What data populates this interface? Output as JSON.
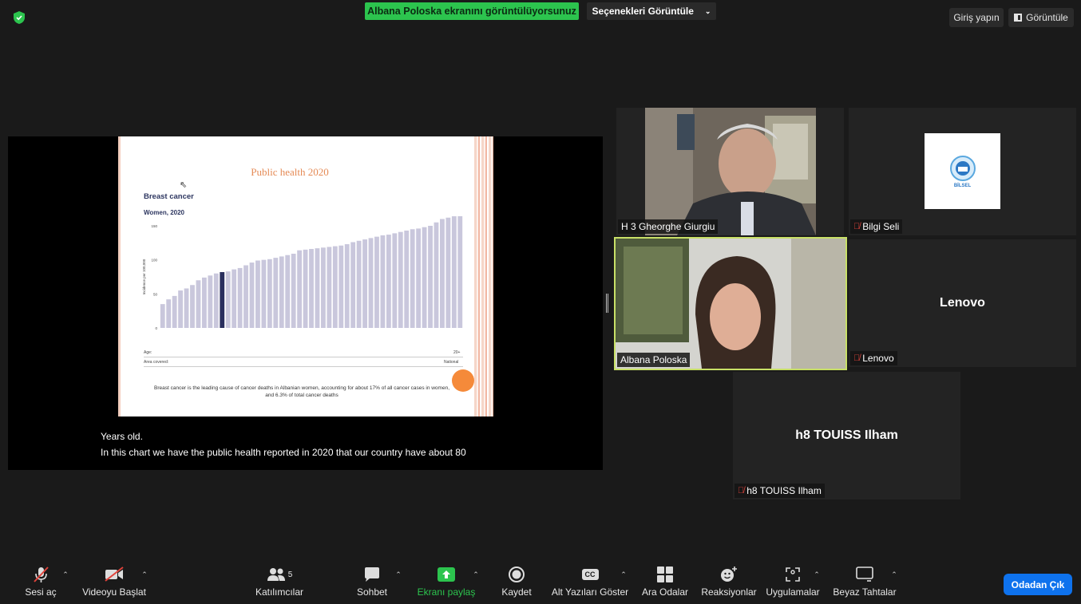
{
  "topbar": {
    "share_banner": "Albana Poloska ekranını görüntülüyorsunuz",
    "view_options": "Seçenekleri Görüntüle",
    "signin": "Giriş yapın",
    "view": "Görüntüle"
  },
  "slide": {
    "title": "Public health 2020",
    "chart_title": "Breast cancer",
    "chart_subtitle": "Women, 2020",
    "age_label": "Age:",
    "age_value": "20+",
    "area_label": "Area covered:",
    "area_value": "National",
    "caption": "Breast cancer is the leading cause of cancer deaths in Albanian women, accounting for about 17% of all cancer cases in women, and 6.3% of total cancer deaths",
    "colors": {
      "bar": "#c9c7dc",
      "highlight": "#2a2f5e",
      "title": "#e58a55"
    }
  },
  "chart_data": {
    "type": "bar",
    "ylabel": "Incidence per 100,000",
    "ylim": [
      0,
      150
    ],
    "yticks": [
      0,
      50,
      100,
      150
    ],
    "highlight_index": 10,
    "values": [
      35,
      42,
      47,
      55,
      58,
      63,
      70,
      74,
      77,
      80,
      82,
      83,
      86,
      88,
      92,
      96,
      99,
      100,
      101,
      103,
      105,
      107,
      109,
      114,
      115,
      116,
      117,
      118,
      119,
      120,
      121,
      123,
      126,
      128,
      130,
      132,
      134,
      136,
      137,
      139,
      141,
      143,
      145,
      146,
      148,
      150,
      155,
      160,
      162,
      164,
      183
    ]
  },
  "captions": {
    "line1": "Years old.",
    "line2": "In this chart we have the public health reported in 2020 that our country have about 80"
  },
  "participants": [
    {
      "name": "H 3 Gheorghe Giurgiu",
      "muted": false
    },
    {
      "name": "Bilgi Seli",
      "muted": true,
      "logo_text": "BİLSEL"
    },
    {
      "name": "Albana Poloska",
      "muted": false
    },
    {
      "name": "Lenovo",
      "muted": true,
      "display": "Lenovo"
    },
    {
      "name": "h8 TOUISS Ilham",
      "muted": true,
      "display": "h8 TOUISS Ilham"
    }
  ],
  "toolbar": {
    "unmute": "Sesi aç",
    "start_video": "Videoyu Başlat",
    "participants": "Katılımcılar",
    "participants_count": "5",
    "chat": "Sohbet",
    "share": "Ekranı paylaş",
    "record": "Kaydet",
    "captions": "Alt Yazıları Göster",
    "cc": "CC",
    "breakout": "Ara Odalar",
    "reactions": "Reaksiyonlar",
    "apps": "Uygulamalar",
    "whiteboard": "Beyaz Tahtalar",
    "leave": "Odadan Çık"
  }
}
